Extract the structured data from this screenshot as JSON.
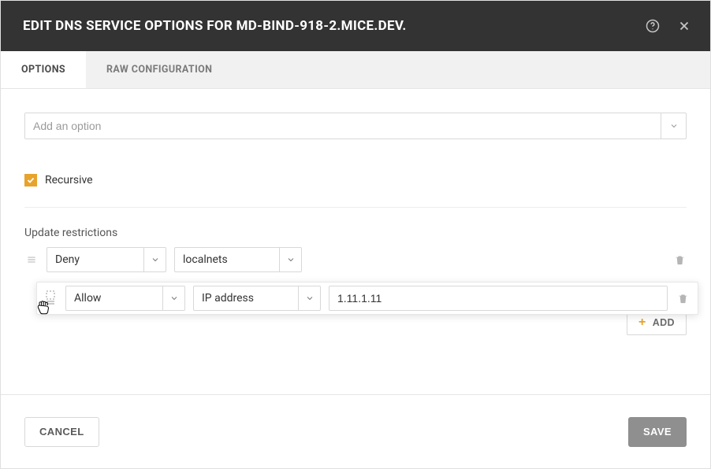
{
  "colors": {
    "accent": "#e7a32c",
    "header_bg": "#333333"
  },
  "header": {
    "title": "EDIT DNS SERVICE OPTIONS FOR MD-BIND-918-2.MICE.DEV."
  },
  "tabs": {
    "options": "OPTIONS",
    "raw_config": "RAW CONFIGURATION",
    "active": "options"
  },
  "add_option": {
    "placeholder": "Add an option"
  },
  "recursive": {
    "label": "Recursive",
    "checked": true
  },
  "restrictions": {
    "label": "Update restrictions",
    "rows": [
      {
        "policy": "Deny",
        "match_type": "localnets",
        "value": null
      },
      {
        "policy": "Allow",
        "match_type": "IP address",
        "value": "1.11.1.11"
      }
    ],
    "add_label": "ADD"
  },
  "footer": {
    "cancel": "CANCEL",
    "save": "SAVE"
  }
}
